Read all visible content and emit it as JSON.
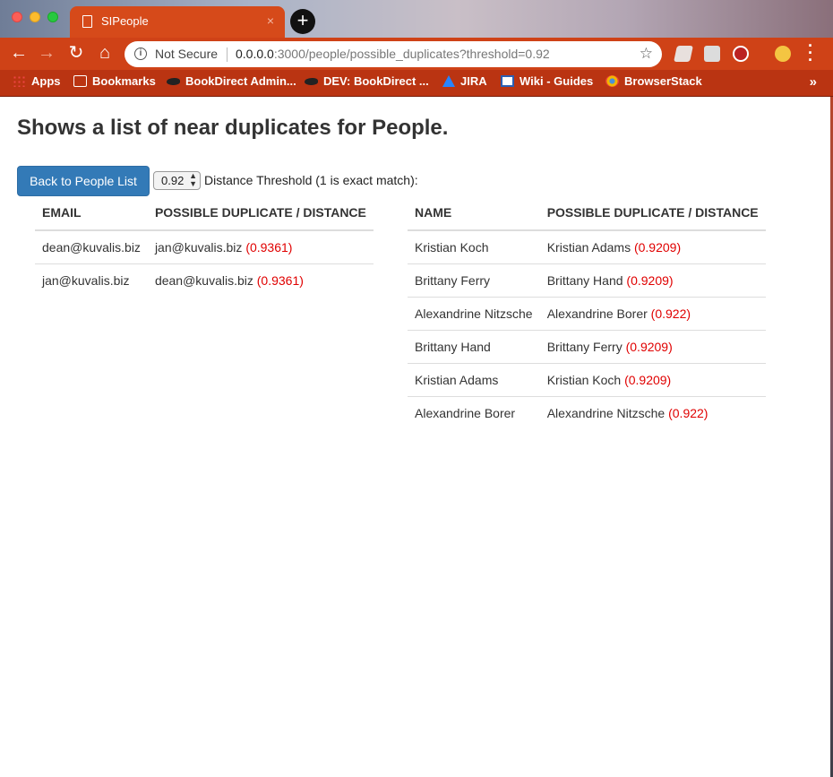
{
  "browser": {
    "tab_title": "SIPeople",
    "tab_close": "×",
    "new_tab": "+",
    "not_secure": "Not Secure",
    "url_host": "0.0.0.0",
    "url_rest": ":3000/people/possible_duplicates?threshold=0.92",
    "bookmarks": [
      "Apps",
      "Bookmarks",
      "BookDirect Admin...",
      "DEV: BookDirect ...",
      "JIRA",
      "Wiki - Guides",
      "BrowserStack"
    ],
    "bookmarks_more": "»",
    "icons": [
      "back-icon",
      "forward-icon",
      "reload-icon",
      "home-icon",
      "info-icon",
      "star-icon",
      "menu-icon"
    ],
    "accent": "#cf4217"
  },
  "page": {
    "title": "Shows a list of near duplicates for People.",
    "back_button": "Back to People List",
    "threshold_value": "0.92",
    "threshold_label": "Distance Threshold (1 is exact match):"
  },
  "email_table": {
    "headers": [
      "EMAIL",
      "POSSIBLE DUPLICATE / DISTANCE"
    ],
    "rows": [
      {
        "primary": "dean@kuvalis.biz",
        "duplicate": "jan@kuvalis.biz",
        "distance": "(0.9361)"
      },
      {
        "primary": "jan@kuvalis.biz",
        "duplicate": "dean@kuvalis.biz",
        "distance": "(0.9361)"
      }
    ]
  },
  "name_table": {
    "headers": [
      "NAME",
      "POSSIBLE DUPLICATE / DISTANCE"
    ],
    "rows": [
      {
        "primary": "Kristian Koch",
        "duplicate": "Kristian Adams",
        "distance": "(0.9209)"
      },
      {
        "primary": "Brittany Ferry",
        "duplicate": "Brittany Hand",
        "distance": "(0.9209)"
      },
      {
        "primary": "Alexandrine Nitzsche",
        "duplicate": "Alexandrine Borer",
        "distance": "(0.922)"
      },
      {
        "primary": "Brittany Hand",
        "duplicate": "Brittany Ferry",
        "distance": "(0.9209)"
      },
      {
        "primary": "Kristian Adams",
        "duplicate": "Kristian Koch",
        "distance": "(0.9209)"
      },
      {
        "primary": "Alexandrine Borer",
        "duplicate": "Alexandrine Nitzsche",
        "distance": "(0.922)"
      }
    ]
  },
  "colors": {
    "button": "#337ab7",
    "distance": "#e00000"
  }
}
